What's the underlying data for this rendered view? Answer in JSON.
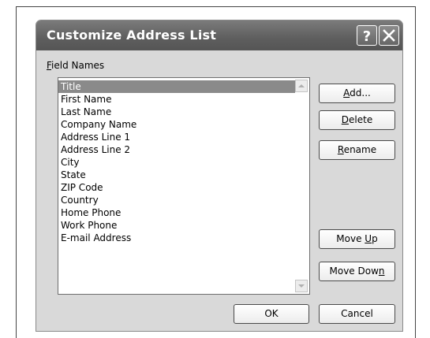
{
  "dialog": {
    "title": "Customize Address List",
    "help_icon": "help-icon",
    "close_icon": "close-icon"
  },
  "field_names": {
    "label_prefix": "",
    "label_underlined": "F",
    "label_rest": "ield Names",
    "items": [
      "Title",
      "First Name",
      "Last Name",
      "Company Name",
      "Address Line 1",
      "Address Line 2",
      "City",
      "State",
      "ZIP Code",
      "Country",
      "Home Phone",
      "Work Phone",
      "E-mail Address"
    ],
    "selected": "Title"
  },
  "buttons": {
    "add": {
      "pre": "",
      "key": "A",
      "post": "dd..."
    },
    "delete": {
      "pre": "",
      "key": "D",
      "post": "elete"
    },
    "rename": {
      "pre": "",
      "key": "R",
      "post": "ename"
    },
    "move_up": {
      "pre": "Move ",
      "key": "U",
      "post": "p"
    },
    "move_down": {
      "pre": "Move Dow",
      "key": "n",
      "post": ""
    },
    "ok": "OK",
    "cancel": "Cancel"
  }
}
